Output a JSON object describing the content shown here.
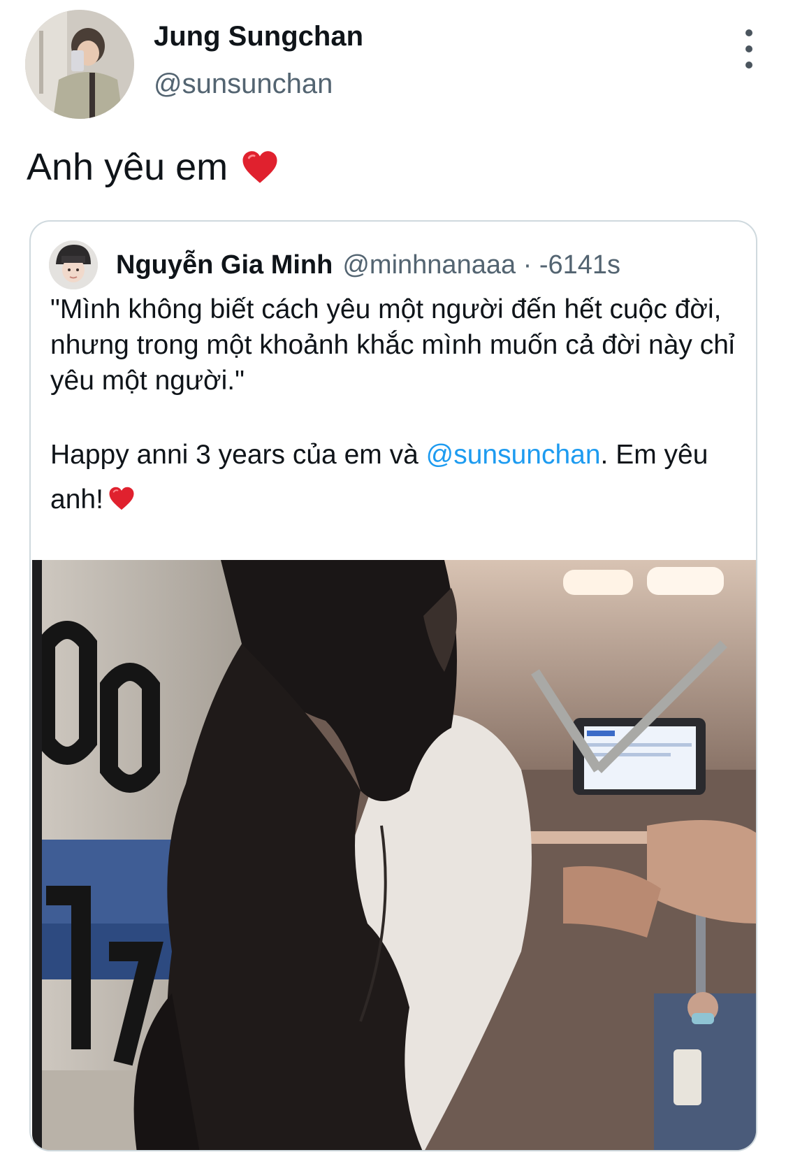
{
  "tweet": {
    "author_name": "Jung Sungchan",
    "author_handle": "@sunsunchan",
    "text": "Anh yêu em",
    "text_emoji": "red-heart-emoji"
  },
  "quoted_tweet": {
    "author_name": "Nguyễn Gia Minh",
    "author_handle_time": "@minhnanaaa · -6141s",
    "line1": "\"Mình không biết cách yêu một người đến hết cuộc đời, nhưng trong một khoảnh khắc mình muốn cả đời này chỉ yêu một người.\"",
    "line2_before": "Happy anni 3 years của em và ",
    "line2_mention": "@sunsunchan",
    "line2_after": ". Em yêu anh!",
    "line2_emoji": "red-heart-emoji"
  },
  "colors": {
    "mention": "#1d9bf0",
    "secondary_text": "#536471",
    "heart": "#e0212e"
  }
}
